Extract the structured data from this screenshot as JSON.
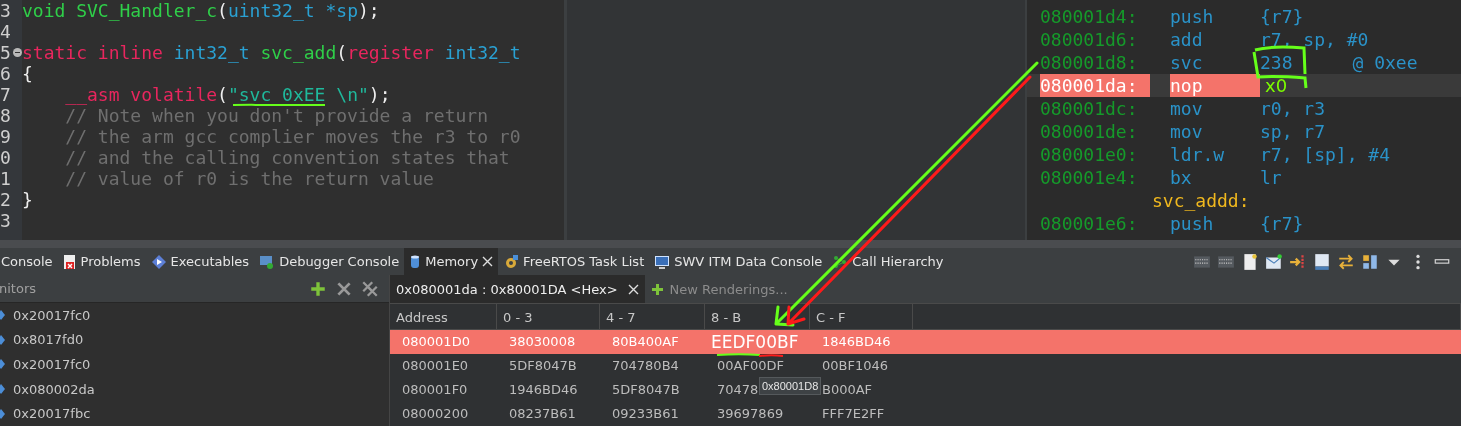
{
  "editor": {
    "lines": [
      {
        "number": "3",
        "fold": false,
        "tokens": [
          {
            "kind": "func",
            "text": "void SVC_Handler_c"
          },
          {
            "kind": "plain",
            "text": "("
          },
          {
            "kind": "type",
            "text": "uint32_t *sp"
          },
          {
            "kind": "plain",
            "text": ");"
          }
        ]
      },
      {
        "number": "4",
        "fold": false
      },
      {
        "number": "5",
        "fold": true,
        "tokens": [
          {
            "kind": "keyword",
            "text": "static inline "
          },
          {
            "kind": "type",
            "text": "int32_t "
          },
          {
            "kind": "func",
            "text": "svc_add"
          },
          {
            "kind": "plain",
            "text": "("
          },
          {
            "kind": "keyword",
            "text": "register "
          },
          {
            "kind": "type",
            "text": "int32_t"
          }
        ]
      },
      {
        "number": "6",
        "fold": false,
        "tokens": [
          {
            "kind": "plain",
            "text": "{"
          }
        ]
      },
      {
        "number": "7",
        "fold": false,
        "tokens": [
          {
            "kind": "keyword",
            "text": "    __asm volatile"
          },
          {
            "kind": "plain",
            "text": "("
          },
          {
            "kind": "string",
            "text": "\"svc 0xEE \\n\""
          },
          {
            "kind": "plain",
            "text": ");"
          }
        ]
      },
      {
        "number": "8",
        "fold": false,
        "tokens": [
          {
            "kind": "comment",
            "text": "    // Note when you don't provide a return"
          }
        ]
      },
      {
        "number": "9",
        "fold": false,
        "tokens": [
          {
            "kind": "comment",
            "text": "    // the arm gcc complier moves the r3 to r0"
          }
        ]
      },
      {
        "number": "0",
        "fold": false,
        "tokens": [
          {
            "kind": "comment",
            "text": "    // and the calling convention states that"
          }
        ]
      },
      {
        "number": "1",
        "fold": false,
        "tokens": [
          {
            "kind": "comment",
            "text": "    // value of r0 is the return value"
          }
        ]
      },
      {
        "number": "2",
        "fold": false,
        "tokens": [
          {
            "kind": "plain",
            "text": "}"
          }
        ]
      },
      {
        "number": "3",
        "fold": false
      }
    ]
  },
  "disassembly": {
    "rows": [
      {
        "kind": "instruction",
        "address": "080001d4:",
        "mnemonic": "push",
        "operands": "{r7}",
        "current": false
      },
      {
        "kind": "instruction",
        "address": "080001d6:",
        "mnemonic": "add",
        "operands": "r7, sp, #0",
        "current": false
      },
      {
        "kind": "instruction",
        "address": "080001d8:",
        "mnemonic": "svc",
        "operands": "238",
        "comment": "@ 0xee",
        "current": false
      },
      {
        "kind": "instruction",
        "address": "080001da:",
        "mnemonic": "nop",
        "current": true
      },
      {
        "kind": "instruction",
        "address": "080001dc:",
        "mnemonic": "mov",
        "operands": "r0, r3",
        "current": false
      },
      {
        "kind": "instruction",
        "address": "080001de:",
        "mnemonic": "mov",
        "operands": "sp, r7",
        "current": false
      },
      {
        "kind": "instruction",
        "address": "080001e0:",
        "mnemonic": "ldr.w",
        "operands": "r7, [sp], #4",
        "current": false
      },
      {
        "kind": "instruction",
        "address": "080001e4:",
        "mnemonic": "bx",
        "operands": "lr",
        "current": false
      },
      {
        "kind": "label",
        "text": "svc_addd:"
      },
      {
        "kind": "instruction",
        "address": "080001e6:",
        "mnemonic": "push",
        "operands": "{r7}",
        "current": false
      }
    ]
  },
  "view_tabs": [
    {
      "label": "Console",
      "selected": false,
      "closable": false
    },
    {
      "label": "Problems",
      "selected": false,
      "closable": false
    },
    {
      "label": "Executables",
      "selected": false,
      "closable": false
    },
    {
      "label": "Debugger Console",
      "selected": false,
      "closable": false
    },
    {
      "label": "Memory",
      "selected": true,
      "closable": true
    },
    {
      "label": "FreeRTOS Task List",
      "selected": false,
      "closable": false
    },
    {
      "label": "SWV ITM Data Console",
      "selected": false,
      "closable": false
    },
    {
      "label": "Call Hierarchy",
      "selected": false,
      "closable": false
    }
  ],
  "monitors": {
    "title": "nitors",
    "items": [
      "0x20017fc0",
      "0x8017fd0",
      "0x20017fc0",
      "0x080002da",
      "0x20017fbc"
    ]
  },
  "memory": {
    "rendering_tabs": [
      {
        "label": "0x080001da : 0x80001DA <Hex>",
        "selected": true
      }
    ],
    "new_renderings": "New Renderings...",
    "columns": [
      "Address",
      "0 - 3",
      "4 - 7",
      "8 - B",
      "C - F"
    ],
    "rows": [
      {
        "selected": true,
        "cells": [
          {
            "text": "080001D0",
            "editing": false
          },
          {
            "text": "38030008",
            "editing": false
          },
          {
            "text": "80B400AF",
            "editing": false
          },
          {
            "text": "EEDF00BF",
            "editing": true
          },
          {
            "text": "1846BD46",
            "editing": false
          }
        ]
      },
      {
        "selected": false,
        "cells": [
          {
            "text": "080001E0",
            "editing": false
          },
          {
            "text": "5DF8047B",
            "editing": false
          },
          {
            "text": "704780B4",
            "editing": false
          },
          {
            "text": "00AF00DF",
            "editing": false
          },
          {
            "text": "00BF1046",
            "editing": false
          }
        ]
      },
      {
        "selected": false,
        "cells": [
          {
            "text": "080001F0",
            "editing": false
          },
          {
            "text": "1946BD46",
            "editing": false
          },
          {
            "text": "5DF8047B",
            "editing": false
          },
          {
            "text": "70478",
            "editing": false
          },
          {
            "text": "B000AF",
            "editing": false
          }
        ]
      },
      {
        "selected": false,
        "cells": [
          {
            "text": "08000200",
            "editing": false
          },
          {
            "text": "08237B61",
            "editing": false
          },
          {
            "text": "09233B61",
            "editing": false
          },
          {
            "text": "39697869",
            "editing": false
          },
          {
            "text": "FFF7E2FF",
            "editing": false
          }
        ]
      }
    ],
    "tooltip": "0x80001D8"
  },
  "annotation_note": "x0"
}
